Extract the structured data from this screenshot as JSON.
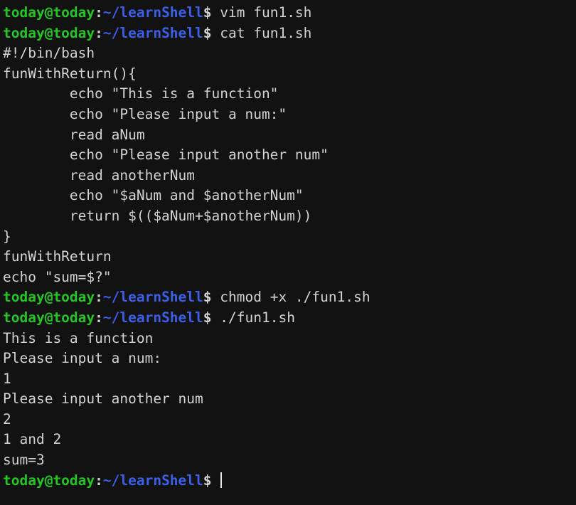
{
  "terminal": {
    "background_color": "#121212",
    "foreground_color": "#d2d2d2",
    "user_color": "#26c426",
    "path_color": "#3b5fe8",
    "cursor_color": "#e8e8e8",
    "prompt": {
      "user_host": "today@today",
      "separator": ":",
      "path": "~/learnShell",
      "sigil": "$"
    },
    "lines": [
      {
        "type": "prompt",
        "command": " vim fun1.sh"
      },
      {
        "type": "prompt",
        "command": " cat fun1.sh"
      },
      {
        "type": "output",
        "text": "#!/bin/bash"
      },
      {
        "type": "output",
        "text": "funWithReturn(){"
      },
      {
        "type": "output",
        "text": "        echo \"This is a function\""
      },
      {
        "type": "output",
        "text": "        echo \"Please input a num:\""
      },
      {
        "type": "output",
        "text": "        read aNum"
      },
      {
        "type": "output",
        "text": "        echo \"Please input another num\""
      },
      {
        "type": "output",
        "text": "        read anotherNum"
      },
      {
        "type": "output",
        "text": "        echo \"$aNum and $anotherNum\""
      },
      {
        "type": "output",
        "text": "        return $(($aNum+$anotherNum))"
      },
      {
        "type": "output",
        "text": "}"
      },
      {
        "type": "output",
        "text": "funWithReturn"
      },
      {
        "type": "output",
        "text": "echo \"sum=$?\""
      },
      {
        "type": "prompt",
        "command": " chmod +x ./fun1.sh"
      },
      {
        "type": "prompt",
        "command": " ./fun1.sh"
      },
      {
        "type": "output",
        "text": "This is a function"
      },
      {
        "type": "output",
        "text": "Please input a num:"
      },
      {
        "type": "output",
        "text": "1"
      },
      {
        "type": "output",
        "text": "Please input another num"
      },
      {
        "type": "output",
        "text": "2"
      },
      {
        "type": "output",
        "text": "1 and 2"
      },
      {
        "type": "output",
        "text": "sum=3"
      },
      {
        "type": "prompt",
        "command": " ",
        "cursor": true
      }
    ]
  }
}
